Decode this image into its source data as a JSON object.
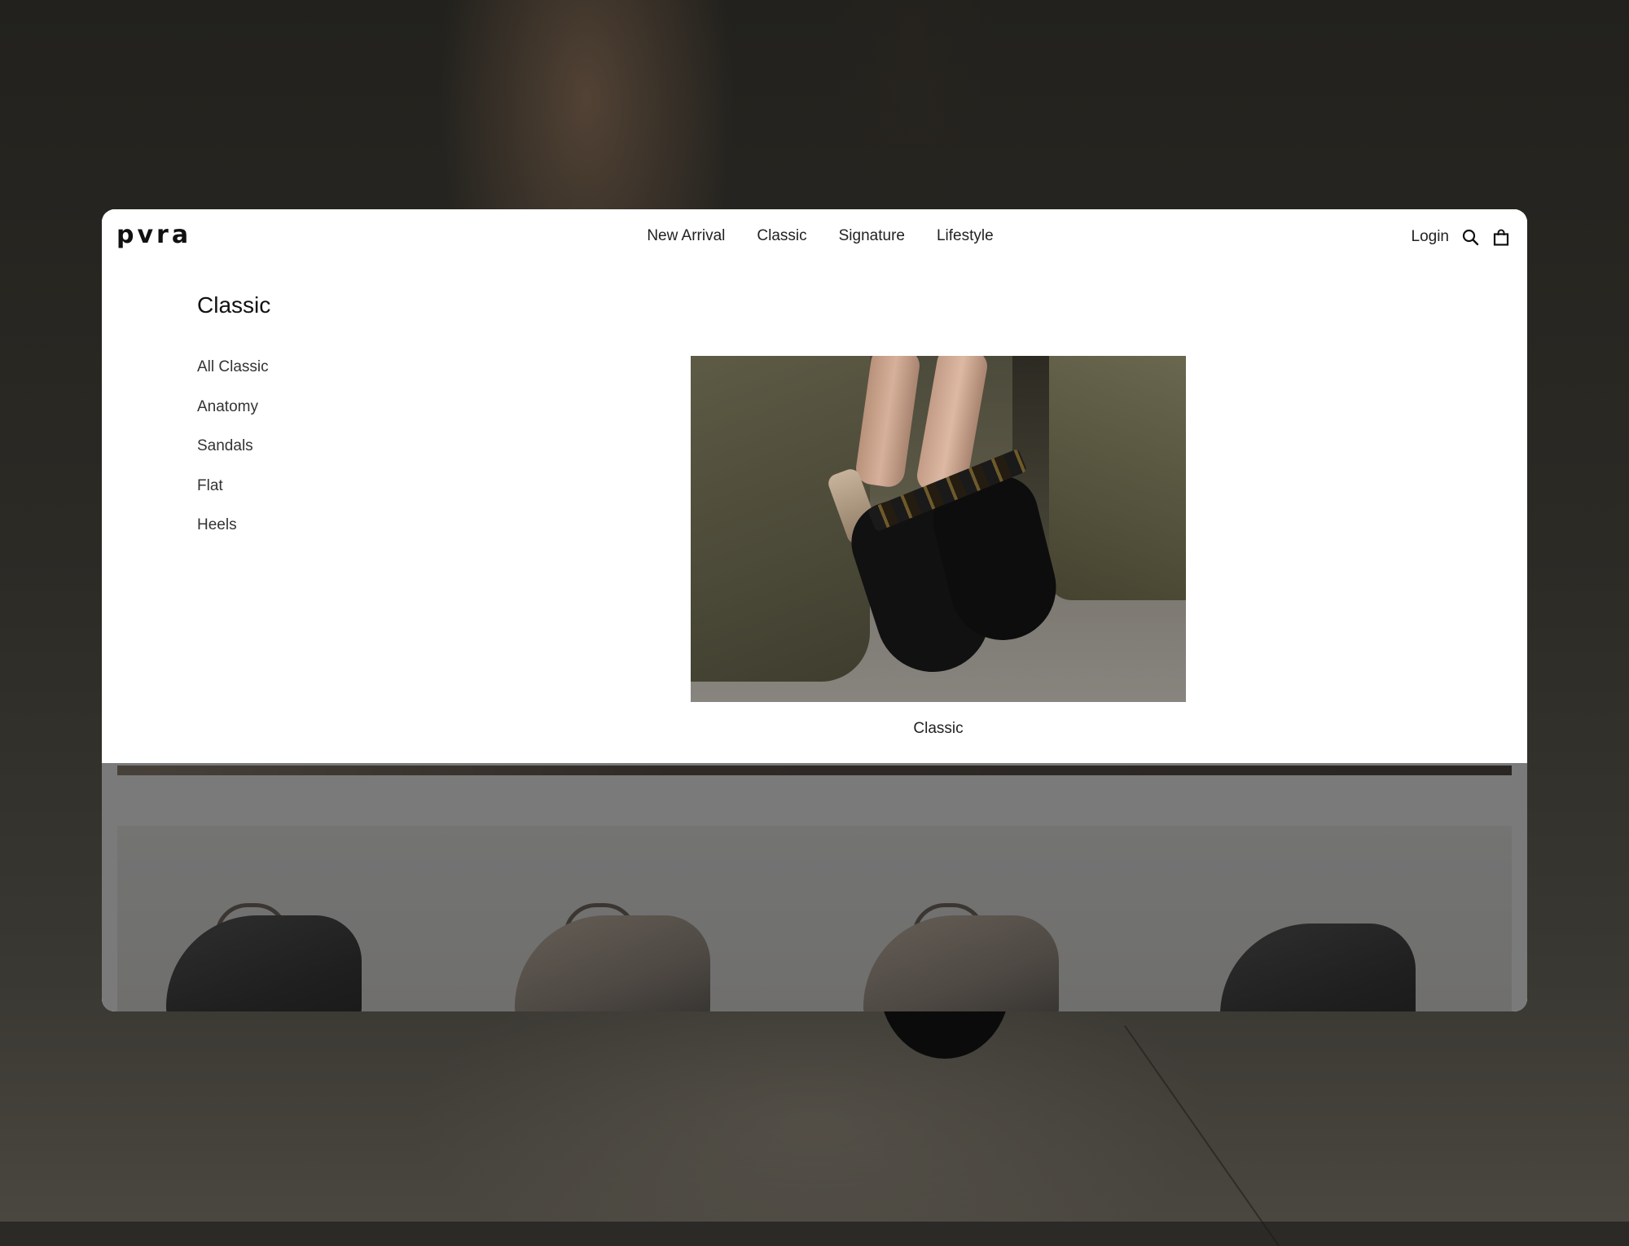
{
  "brand": {
    "logo_text": "pvra"
  },
  "nav": {
    "items": [
      {
        "label": "New Arrival"
      },
      {
        "label": "Classic"
      },
      {
        "label": "Signature"
      },
      {
        "label": "Lifestyle"
      }
    ]
  },
  "header": {
    "login_label": "Login",
    "icons": [
      "search-icon",
      "shopping-bag-icon"
    ]
  },
  "mega_menu": {
    "title": "Classic",
    "items": [
      {
        "label": "All Classic"
      },
      {
        "label": "Anatomy"
      },
      {
        "label": "Sandals"
      },
      {
        "label": "Flat"
      },
      {
        "label": "Heels"
      }
    ],
    "feature": {
      "caption": "Classic"
    }
  },
  "colors": {
    "text": "#222222",
    "background": "#ffffff",
    "overlay": "#282828"
  }
}
